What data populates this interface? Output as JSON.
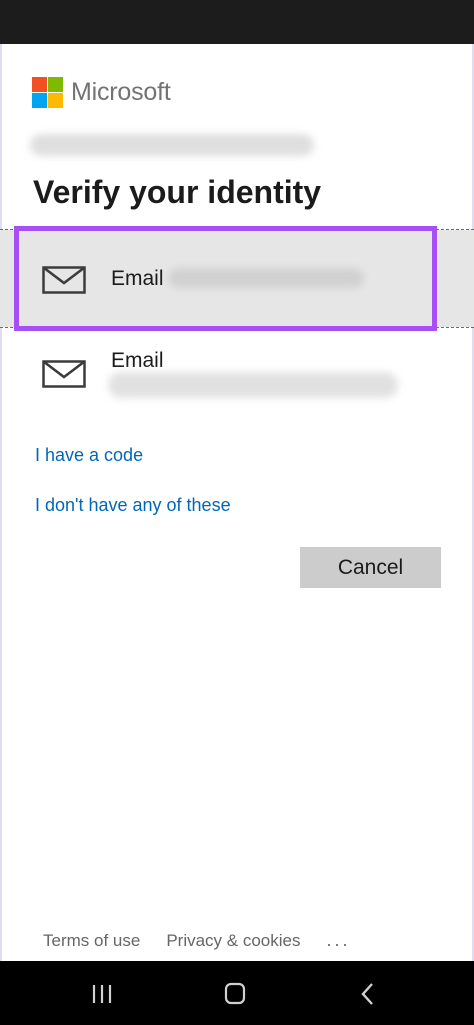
{
  "brand": {
    "name": "Microsoft"
  },
  "page": {
    "title": "Verify your identity"
  },
  "options": [
    {
      "label": "Email",
      "icon": "envelope-icon",
      "selected": true
    },
    {
      "label": "Email",
      "icon": "envelope-icon",
      "selected": false
    }
  ],
  "links": {
    "have_code": "I have a code",
    "dont_have": "I don't have any of these"
  },
  "buttons": {
    "cancel": "Cancel"
  },
  "footer": {
    "terms": "Terms of use",
    "privacy": "Privacy & cookies",
    "more": "..."
  },
  "colors": {
    "highlight": "#a64ff2",
    "link": "#0067b8",
    "selected_bg": "#e6e6e6",
    "button_bg": "#cccccc"
  },
  "system_nav": {
    "recent_icon": "recent-apps-icon",
    "home_icon": "home-icon",
    "back_icon": "back-icon"
  }
}
